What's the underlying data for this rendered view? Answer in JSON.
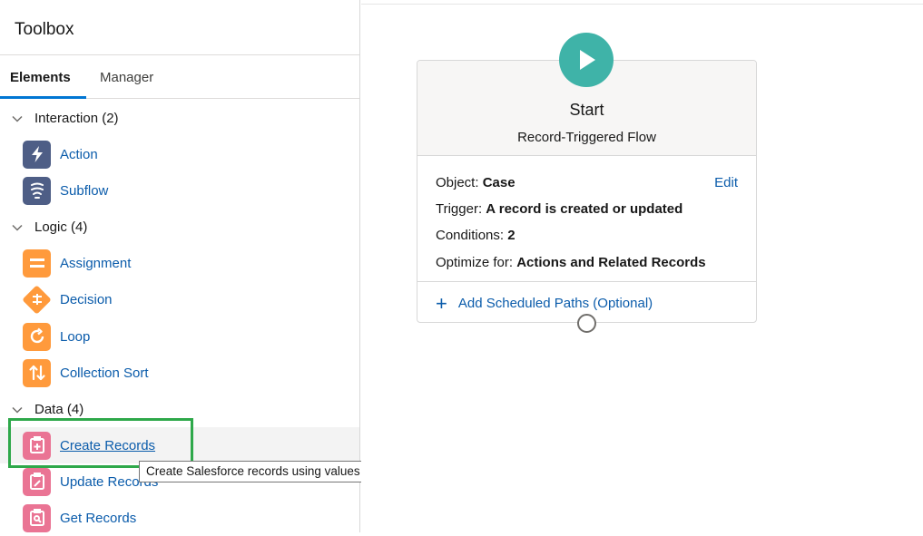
{
  "toolbox": {
    "title": "Toolbox",
    "tabs": [
      {
        "label": "Elements",
        "active": true
      },
      {
        "label": "Manager",
        "active": false
      }
    ],
    "sections": [
      {
        "label": "Interaction (2)",
        "items": [
          {
            "label": "Action",
            "icon": "lightning-icon"
          },
          {
            "label": "Subflow",
            "icon": "subflow-icon"
          }
        ]
      },
      {
        "label": "Logic (4)",
        "items": [
          {
            "label": "Assignment",
            "icon": "assignment-icon"
          },
          {
            "label": "Decision",
            "icon": "decision-icon"
          },
          {
            "label": "Loop",
            "icon": "loop-icon"
          },
          {
            "label": "Collection Sort",
            "icon": "sort-icon"
          }
        ]
      },
      {
        "label": "Data (4)",
        "items": [
          {
            "label": "Create Records",
            "icon": "create-record-icon"
          },
          {
            "label": "Update Records",
            "icon": "update-record-icon"
          },
          {
            "label": "Get Records",
            "icon": "get-record-icon"
          }
        ]
      }
    ],
    "tooltip": "Create Salesforce records using values from the flow."
  },
  "start_element": {
    "title": "Start",
    "subtitle": "Record-Triggered Flow",
    "properties": [
      {
        "label": "Object:",
        "value": "Case"
      },
      {
        "label": "Trigger:",
        "value": "A record is created or updated"
      },
      {
        "label": "Conditions:",
        "value": "2"
      },
      {
        "label": "Optimize for:",
        "value": "Actions and Related Records"
      }
    ],
    "edit_label": "Edit",
    "add_paths_label": "Add Scheduled Paths (Optional)"
  },
  "colors": {
    "accent": "#0176d3",
    "link": "#0b5cab",
    "start_teal": "#3fb3a8",
    "interaction_navy": "#4e5e86",
    "logic_orange": "#ff9a3c",
    "data_pink": "#ea7494",
    "highlight_green": "#2ea84a"
  }
}
